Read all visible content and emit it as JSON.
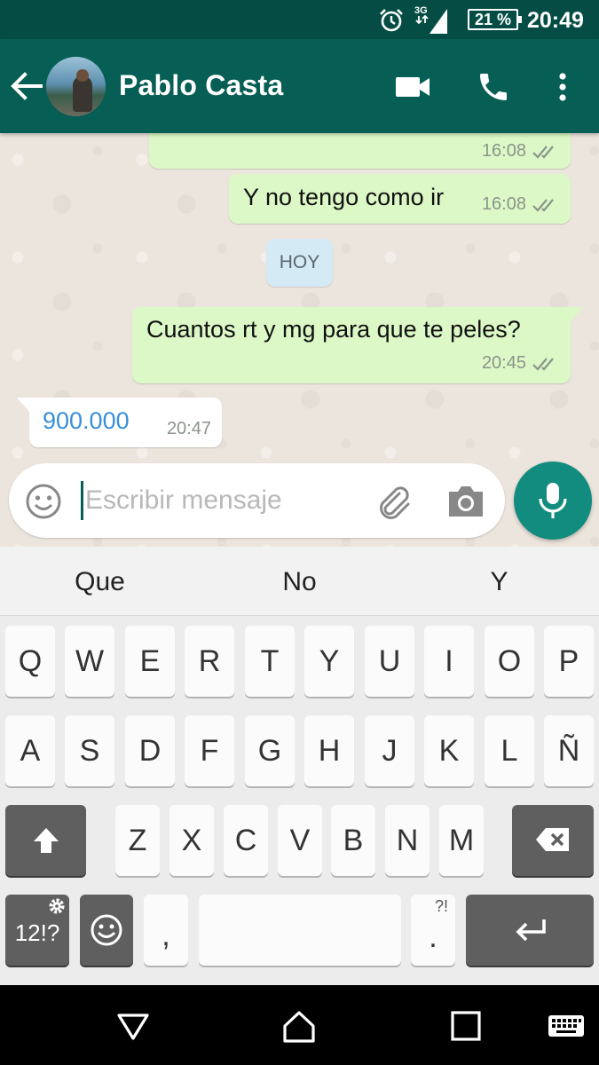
{
  "status_bar": {
    "network": "3G",
    "battery": "21 %",
    "time": "20:49",
    "icons": [
      "alarm-icon",
      "signal-icon",
      "battery-icon"
    ]
  },
  "header": {
    "contact_name": "Pablo Casta",
    "icons": [
      "back-arrow-icon",
      "video-call-icon",
      "phone-icon",
      "more-vert-icon"
    ]
  },
  "chat": {
    "messages": [
      {
        "direction": "outgoing",
        "text": "",
        "time": "16:08",
        "status": "read"
      },
      {
        "direction": "outgoing",
        "text": "Y no tengo como ir",
        "time": "16:08",
        "status": "read"
      },
      {
        "direction": "outgoing",
        "text": "Cuantos rt y mg para que te peles?",
        "time": "20:45",
        "status": "read"
      },
      {
        "direction": "incoming",
        "text": "900.000",
        "time": "20:47"
      }
    ],
    "date_divider": "HOY"
  },
  "composer": {
    "placeholder": "Escribir mensaje",
    "value": ""
  },
  "keyboard": {
    "suggestions": [
      "Que",
      "No",
      "Y"
    ],
    "row1": [
      "Q",
      "W",
      "E",
      "R",
      "T",
      "Y",
      "U",
      "I",
      "O",
      "P"
    ],
    "row2": [
      "A",
      "S",
      "D",
      "F",
      "G",
      "H",
      "J",
      "K",
      "L",
      "Ñ"
    ],
    "row3": [
      "Z",
      "X",
      "C",
      "V",
      "B",
      "N",
      "M"
    ],
    "symbols_label": "12!?",
    "comma": ",",
    "period": ".",
    "period_hint": "?!"
  },
  "colors": {
    "status_bar": "#054d44",
    "app_bar": "#075e54",
    "outgoing_bubble": "#dcf8c6",
    "incoming_bubble": "#ffffff",
    "accent": "#128c7e",
    "link_text": "#3a8fd6",
    "read_ticks": "#8a958a"
  }
}
